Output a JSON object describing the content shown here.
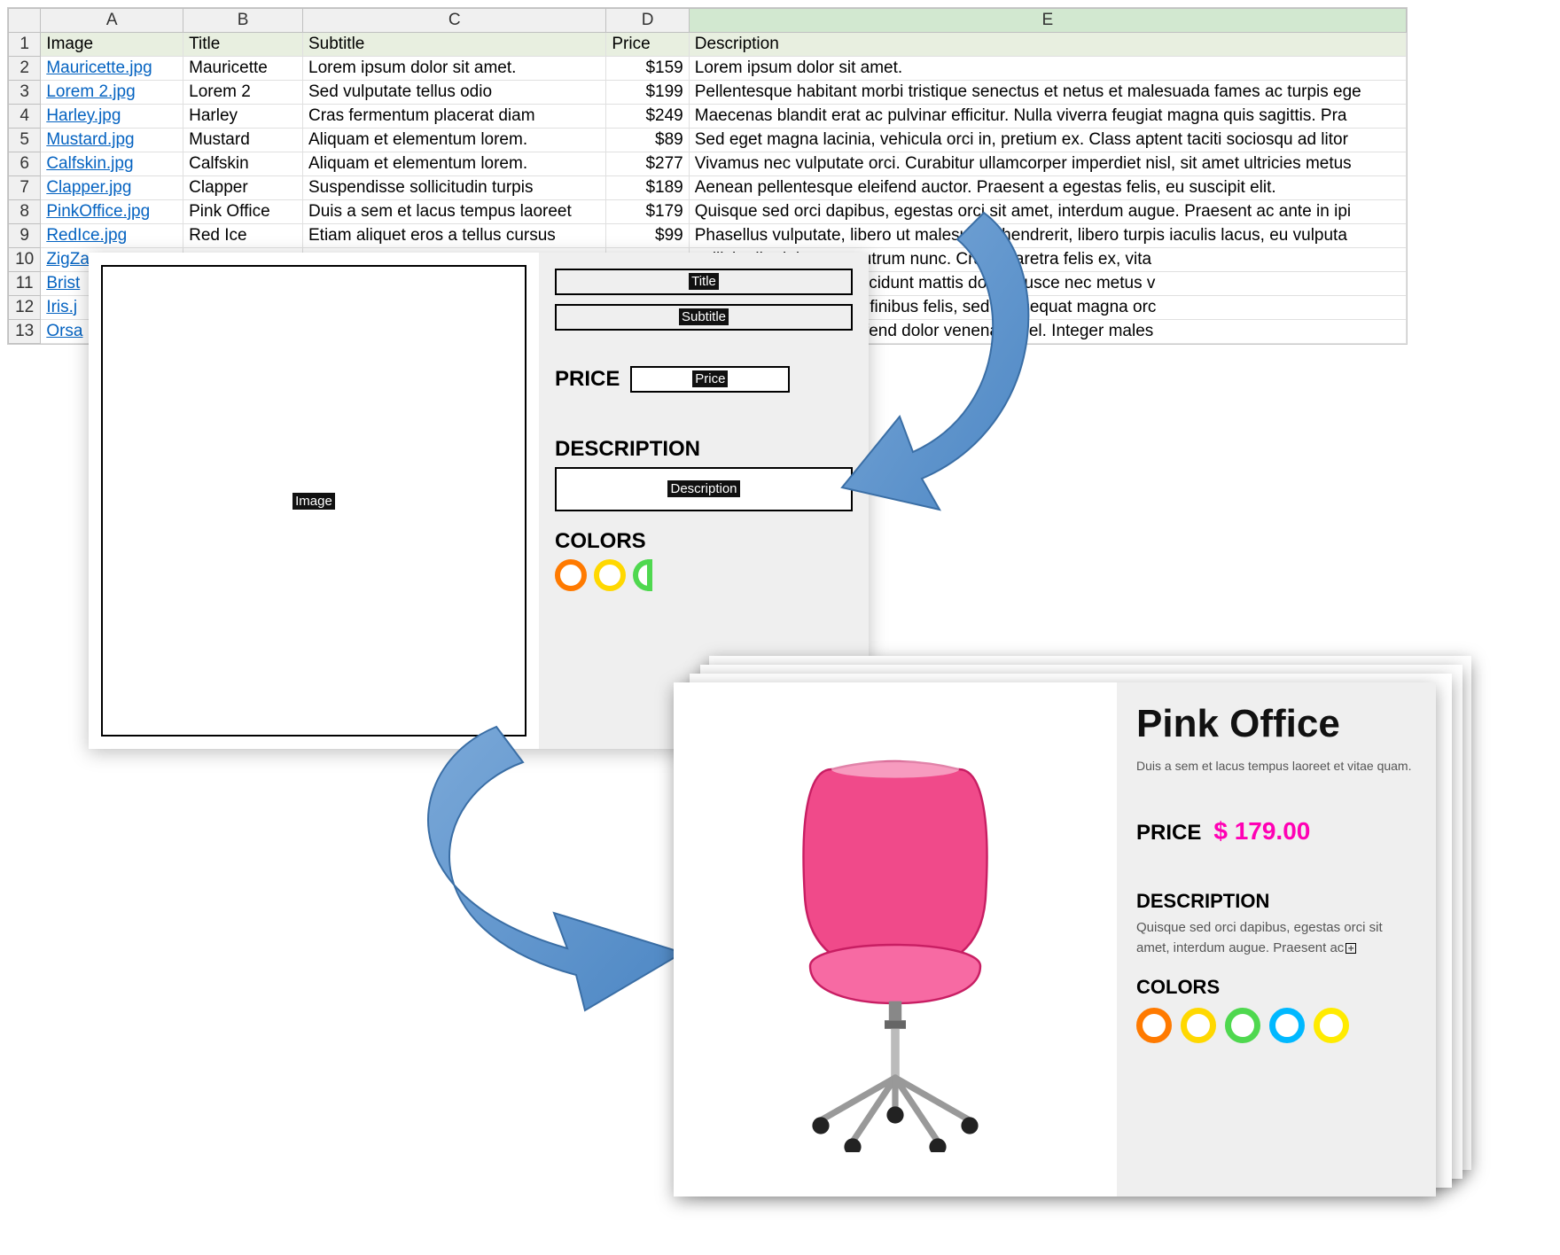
{
  "spreadsheet": {
    "columns": [
      "A",
      "B",
      "C",
      "D",
      "E"
    ],
    "headerRow": [
      "Image",
      "Title",
      "Subtitle",
      "Price",
      "Description"
    ],
    "rows": [
      {
        "n": 2,
        "a": "Mauricette.jpg",
        "b": "Mauricette",
        "c": "Lorem ipsum dolor sit amet.",
        "d": "$159",
        "e": "Lorem ipsum dolor sit amet."
      },
      {
        "n": 3,
        "a": "Lorem 2.jpg",
        "b": "Lorem 2",
        "c": "Sed vulputate tellus odio",
        "d": "$199",
        "e": "Pellentesque habitant morbi tristique senectus et netus et malesuada fames ac turpis ege"
      },
      {
        "n": 4,
        "a": "Harley.jpg",
        "b": "Harley",
        "c": "Cras fermentum placerat diam",
        "d": "$249",
        "e": "Maecenas blandit erat ac pulvinar efficitur. Nulla viverra feugiat magna quis sagittis. Pra"
      },
      {
        "n": 5,
        "a": "Mustard.jpg",
        "b": "Mustard",
        "c": "Aliquam et elementum lorem.",
        "d": "$89",
        "e": "Sed eget magna lacinia, vehicula orci in, pretium ex. Class aptent taciti sociosqu ad litor"
      },
      {
        "n": 6,
        "a": "Calfskin.jpg",
        "b": "Calfskin",
        "c": "Aliquam et elementum lorem.",
        "d": "$277",
        "e": "Vivamus nec vulputate orci. Curabitur ullamcorper imperdiet nisl, sit amet ultricies metus"
      },
      {
        "n": 7,
        "a": "Clapper.jpg",
        "b": "Clapper",
        "c": " Suspendisse sollicitudin turpis",
        "d": "$189",
        "e": "Aenean pellentesque eleifend auctor. Praesent a egestas felis, eu suscipit elit."
      },
      {
        "n": 8,
        "a": "PinkOffice.jpg",
        "b": "Pink Office",
        "c": "Duis a sem et lacus tempus laoreet",
        "d": "$179",
        "e": "Quisque sed orci dapibus, egestas orci sit amet, interdum augue. Praesent ac ante in ipi"
      },
      {
        "n": 9,
        "a": "RedIce.jpg",
        "b": "Red Ice",
        "c": "Etiam aliquet eros a tellus cursus",
        "d": "$99",
        "e": "Phasellus vulputate, libero ut malesuada hendrerit, libero turpis iaculis lacus, eu vulputa"
      },
      {
        "n": 10,
        "a": "ZigZa",
        "b": "",
        "c": "",
        "d": "",
        "e": "sollicitudin dolor non, rutrum nunc. Cras pharetra felis ex, vita"
      },
      {
        "n": 11,
        "a": "Brist",
        "b": "",
        "c": "",
        "d": "",
        "e": "imus non nunc eget, tincidunt mattis dolor. Fusce nec metus v"
      },
      {
        "n": 12,
        "a": "Iris.j",
        "b": "",
        "c": "",
        "d": "",
        "e": "tique lobortis, lacus elit finibus felis, sed consequat magna orc"
      },
      {
        "n": 13,
        "a": "Orsa",
        "b": "",
        "c": "",
        "d": "",
        "e": "uh augue, sit amet eleifend dolor venenatis vel. Integer males"
      }
    ]
  },
  "template": {
    "imageTag": "Image",
    "titleTag": "Title",
    "subtitleTag": "Subtitle",
    "priceLabel": "PRICE",
    "priceTag": "Price",
    "descLabel": "DESCRIPTION",
    "descTag": "Description",
    "colorsLabel": "COLORS",
    "swatches": [
      "#ff7a00",
      "#ffd800",
      "#4fd84f"
    ]
  },
  "output": {
    "title": "Pink Office",
    "subtitle": "Duis a sem et lacus tempus laoreet et vitae quam.",
    "priceLabel": "PRICE",
    "priceValue": "$ 179.00",
    "descLabel": "DESCRIPTION",
    "descText": "Quisque sed orci dapibus, egestas orci sit amet, interdum augue. Praesent ac",
    "colorsLabel": "COLORS",
    "swatches": [
      "#ff7a00",
      "#ffd800",
      "#4fd84f",
      "#00b8ff",
      "#ffeb00"
    ]
  }
}
